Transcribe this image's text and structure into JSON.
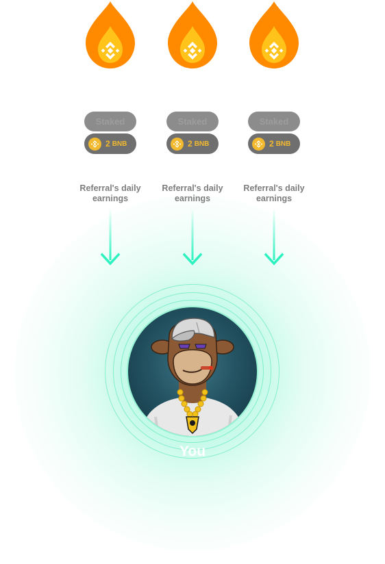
{
  "colors": {
    "flame_outer": "#ff8a00",
    "flame_inner": "#ffc31a",
    "bnb_yellow": "#f3ba2f",
    "pill_grey": "#8c8c8c",
    "pill_dark": "#6f6f6f",
    "arrow_mint": "#2df2c0",
    "glow_mint": "#5cf0be"
  },
  "icons": {
    "flame": "flame-icon",
    "bnb": "bnb-logo-icon",
    "arrow": "arrow-down-icon"
  },
  "referrals": [
    {
      "staked_label": "Staked",
      "amount": "2",
      "unit": "BNB",
      "earnings_label_line1": "Referral's daily",
      "earnings_label_line2": "earnings"
    },
    {
      "staked_label": "Staked",
      "amount": "2",
      "unit": "BNB",
      "earnings_label_line1": "Referral's daily",
      "earnings_label_line2": "earnings"
    },
    {
      "staked_label": "Staked",
      "amount": "2",
      "unit": "BNB",
      "earnings_label_line1": "Referral's daily",
      "earnings_label_line2": "earnings"
    }
  ],
  "you": {
    "label": "You"
  }
}
